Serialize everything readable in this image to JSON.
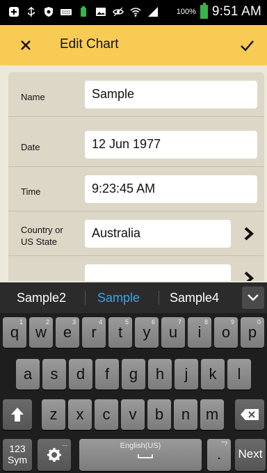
{
  "status_bar": {
    "battery_percent": "100%",
    "time": "9:51 AM",
    "icons": [
      "add-icon",
      "usb-icon",
      "shield-icon",
      "keyboard-icon",
      "battery-full-icon",
      "image-icon",
      "eye-icon",
      "wifi-icon",
      "signal-icon"
    ]
  },
  "app_bar": {
    "title": "Edit Chart",
    "close_icon": "close-icon",
    "confirm_icon": "check-icon",
    "background": "#f8cb55"
  },
  "form": {
    "rows": [
      {
        "label": "Name",
        "value": "Sample"
      },
      {
        "label": "Date",
        "value": "12 Jun 1977"
      },
      {
        "label": "Time",
        "value": "9:23:45 AM"
      },
      {
        "label": "Country or\nUS State",
        "value": "Australia"
      }
    ]
  },
  "suggestions": {
    "items": [
      "Sample2",
      "Sample",
      "Sample4"
    ],
    "active_index": 1,
    "active_color": "#3aa4e8"
  },
  "keyboard": {
    "row1": [
      {
        "k": "q",
        "h": "1"
      },
      {
        "k": "w",
        "h": "2"
      },
      {
        "k": "e",
        "h": "3"
      },
      {
        "k": "r",
        "h": "4"
      },
      {
        "k": "t",
        "h": "5"
      },
      {
        "k": "y",
        "h": "6"
      },
      {
        "k": "u",
        "h": "7"
      },
      {
        "k": "i",
        "h": "8"
      },
      {
        "k": "o",
        "h": "9"
      },
      {
        "k": "p",
        "h": "0"
      }
    ],
    "row2": [
      "a",
      "s",
      "d",
      "f",
      "g",
      "h",
      "j",
      "k",
      "l"
    ],
    "row3": [
      "z",
      "x",
      "c",
      "v",
      "b",
      "n",
      "m"
    ],
    "sym_label_1": "123",
    "sym_label_2": "Sym",
    "space_label": "English(US)",
    "period_hint": "\"?",
    "period": ".",
    "next_label": "Next",
    "settings_hint": "..."
  }
}
